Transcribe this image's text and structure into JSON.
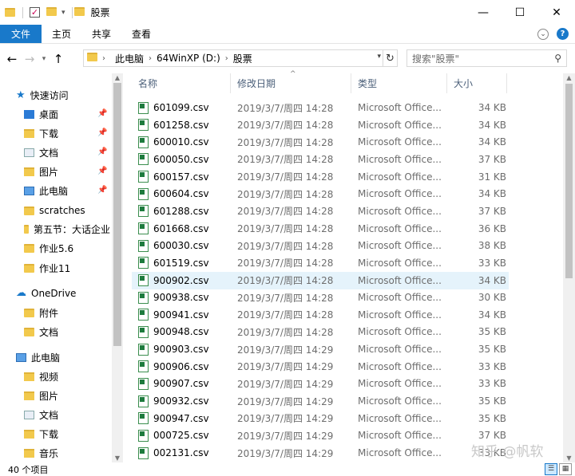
{
  "window": {
    "title": "股票",
    "minimize": "—",
    "maximize": "☐",
    "close": "✕"
  },
  "ribbon": {
    "tabs": [
      "文件",
      "主页",
      "共享",
      "查看"
    ]
  },
  "address": {
    "crumbs": [
      "此电脑",
      "64WinXP  (D:)",
      "股票"
    ],
    "search_placeholder": "搜索\"股票\""
  },
  "nav": {
    "quick_access": "快速访问",
    "items": [
      {
        "label": "桌面",
        "icon": "desktop-icon",
        "pinned": true
      },
      {
        "label": "下载",
        "icon": "download-folder-icon",
        "pinned": true
      },
      {
        "label": "文档",
        "icon": "documents-icon",
        "pinned": true
      },
      {
        "label": "图片",
        "icon": "pictures-icon",
        "pinned": true
      },
      {
        "label": "此电脑",
        "icon": "pc-icon",
        "pinned": true
      },
      {
        "label": "scratches",
        "icon": "folder-icon",
        "pinned": false
      },
      {
        "label": "第五节：大话企业",
        "icon": "folder-icon",
        "pinned": false
      },
      {
        "label": "作业5.6",
        "icon": "folder-icon",
        "pinned": false
      },
      {
        "label": "作业11",
        "icon": "folder-icon",
        "pinned": false
      }
    ],
    "onedrive": "OneDrive",
    "onedrive_items": [
      "附件",
      "文档"
    ],
    "this_pc": "此电脑",
    "pc_items": [
      "视频",
      "图片",
      "文档",
      "下载",
      "音乐"
    ]
  },
  "columns": {
    "name": "名称",
    "date": "修改日期",
    "type": "类型",
    "size": "大小"
  },
  "files": [
    {
      "name": "601099.csv",
      "date": "2019/3/7/周四 14:28",
      "type": "Microsoft Office...",
      "size": "34 KB"
    },
    {
      "name": "601258.csv",
      "date": "2019/3/7/周四 14:28",
      "type": "Microsoft Office...",
      "size": "34 KB"
    },
    {
      "name": "600010.csv",
      "date": "2019/3/7/周四 14:28",
      "type": "Microsoft Office...",
      "size": "34 KB"
    },
    {
      "name": "600050.csv",
      "date": "2019/3/7/周四 14:28",
      "type": "Microsoft Office...",
      "size": "37 KB"
    },
    {
      "name": "600157.csv",
      "date": "2019/3/7/周四 14:28",
      "type": "Microsoft Office...",
      "size": "31 KB"
    },
    {
      "name": "600604.csv",
      "date": "2019/3/7/周四 14:28",
      "type": "Microsoft Office...",
      "size": "34 KB"
    },
    {
      "name": "601288.csv",
      "date": "2019/3/7/周四 14:28",
      "type": "Microsoft Office...",
      "size": "37 KB"
    },
    {
      "name": "601668.csv",
      "date": "2019/3/7/周四 14:28",
      "type": "Microsoft Office...",
      "size": "36 KB"
    },
    {
      "name": "600030.csv",
      "date": "2019/3/7/周四 14:28",
      "type": "Microsoft Office...",
      "size": "38 KB"
    },
    {
      "name": "601519.csv",
      "date": "2019/3/7/周四 14:28",
      "type": "Microsoft Office...",
      "size": "33 KB"
    },
    {
      "name": "900902.csv",
      "date": "2019/3/7/周四 14:28",
      "type": "Microsoft Office...",
      "size": "34 KB",
      "selected": true
    },
    {
      "name": "900938.csv",
      "date": "2019/3/7/周四 14:28",
      "type": "Microsoft Office...",
      "size": "30 KB"
    },
    {
      "name": "900941.csv",
      "date": "2019/3/7/周四 14:28",
      "type": "Microsoft Office...",
      "size": "34 KB"
    },
    {
      "name": "900948.csv",
      "date": "2019/3/7/周四 14:28",
      "type": "Microsoft Office...",
      "size": "35 KB"
    },
    {
      "name": "900903.csv",
      "date": "2019/3/7/周四 14:29",
      "type": "Microsoft Office...",
      "size": "35 KB"
    },
    {
      "name": "900906.csv",
      "date": "2019/3/7/周四 14:29",
      "type": "Microsoft Office...",
      "size": "33 KB"
    },
    {
      "name": "900907.csv",
      "date": "2019/3/7/周四 14:29",
      "type": "Microsoft Office...",
      "size": "33 KB"
    },
    {
      "name": "900932.csv",
      "date": "2019/3/7/周四 14:29",
      "type": "Microsoft Office...",
      "size": "35 KB"
    },
    {
      "name": "900947.csv",
      "date": "2019/3/7/周四 14:29",
      "type": "Microsoft Office...",
      "size": "35 KB"
    },
    {
      "name": "000725.csv",
      "date": "2019/3/7/周四 14:29",
      "type": "Microsoft Office...",
      "size": "37 KB"
    },
    {
      "name": "002131.csv",
      "date": "2019/3/7/周四 14:29",
      "type": "Microsoft Office...",
      "size": "33 KB"
    }
  ],
  "status": {
    "count": "40 个项目"
  },
  "watermark": "知乎 @帆软",
  "colors": {
    "accent": "#1979ca",
    "selected_row": "#e5f3fb",
    "header_text": "#4c607a"
  }
}
